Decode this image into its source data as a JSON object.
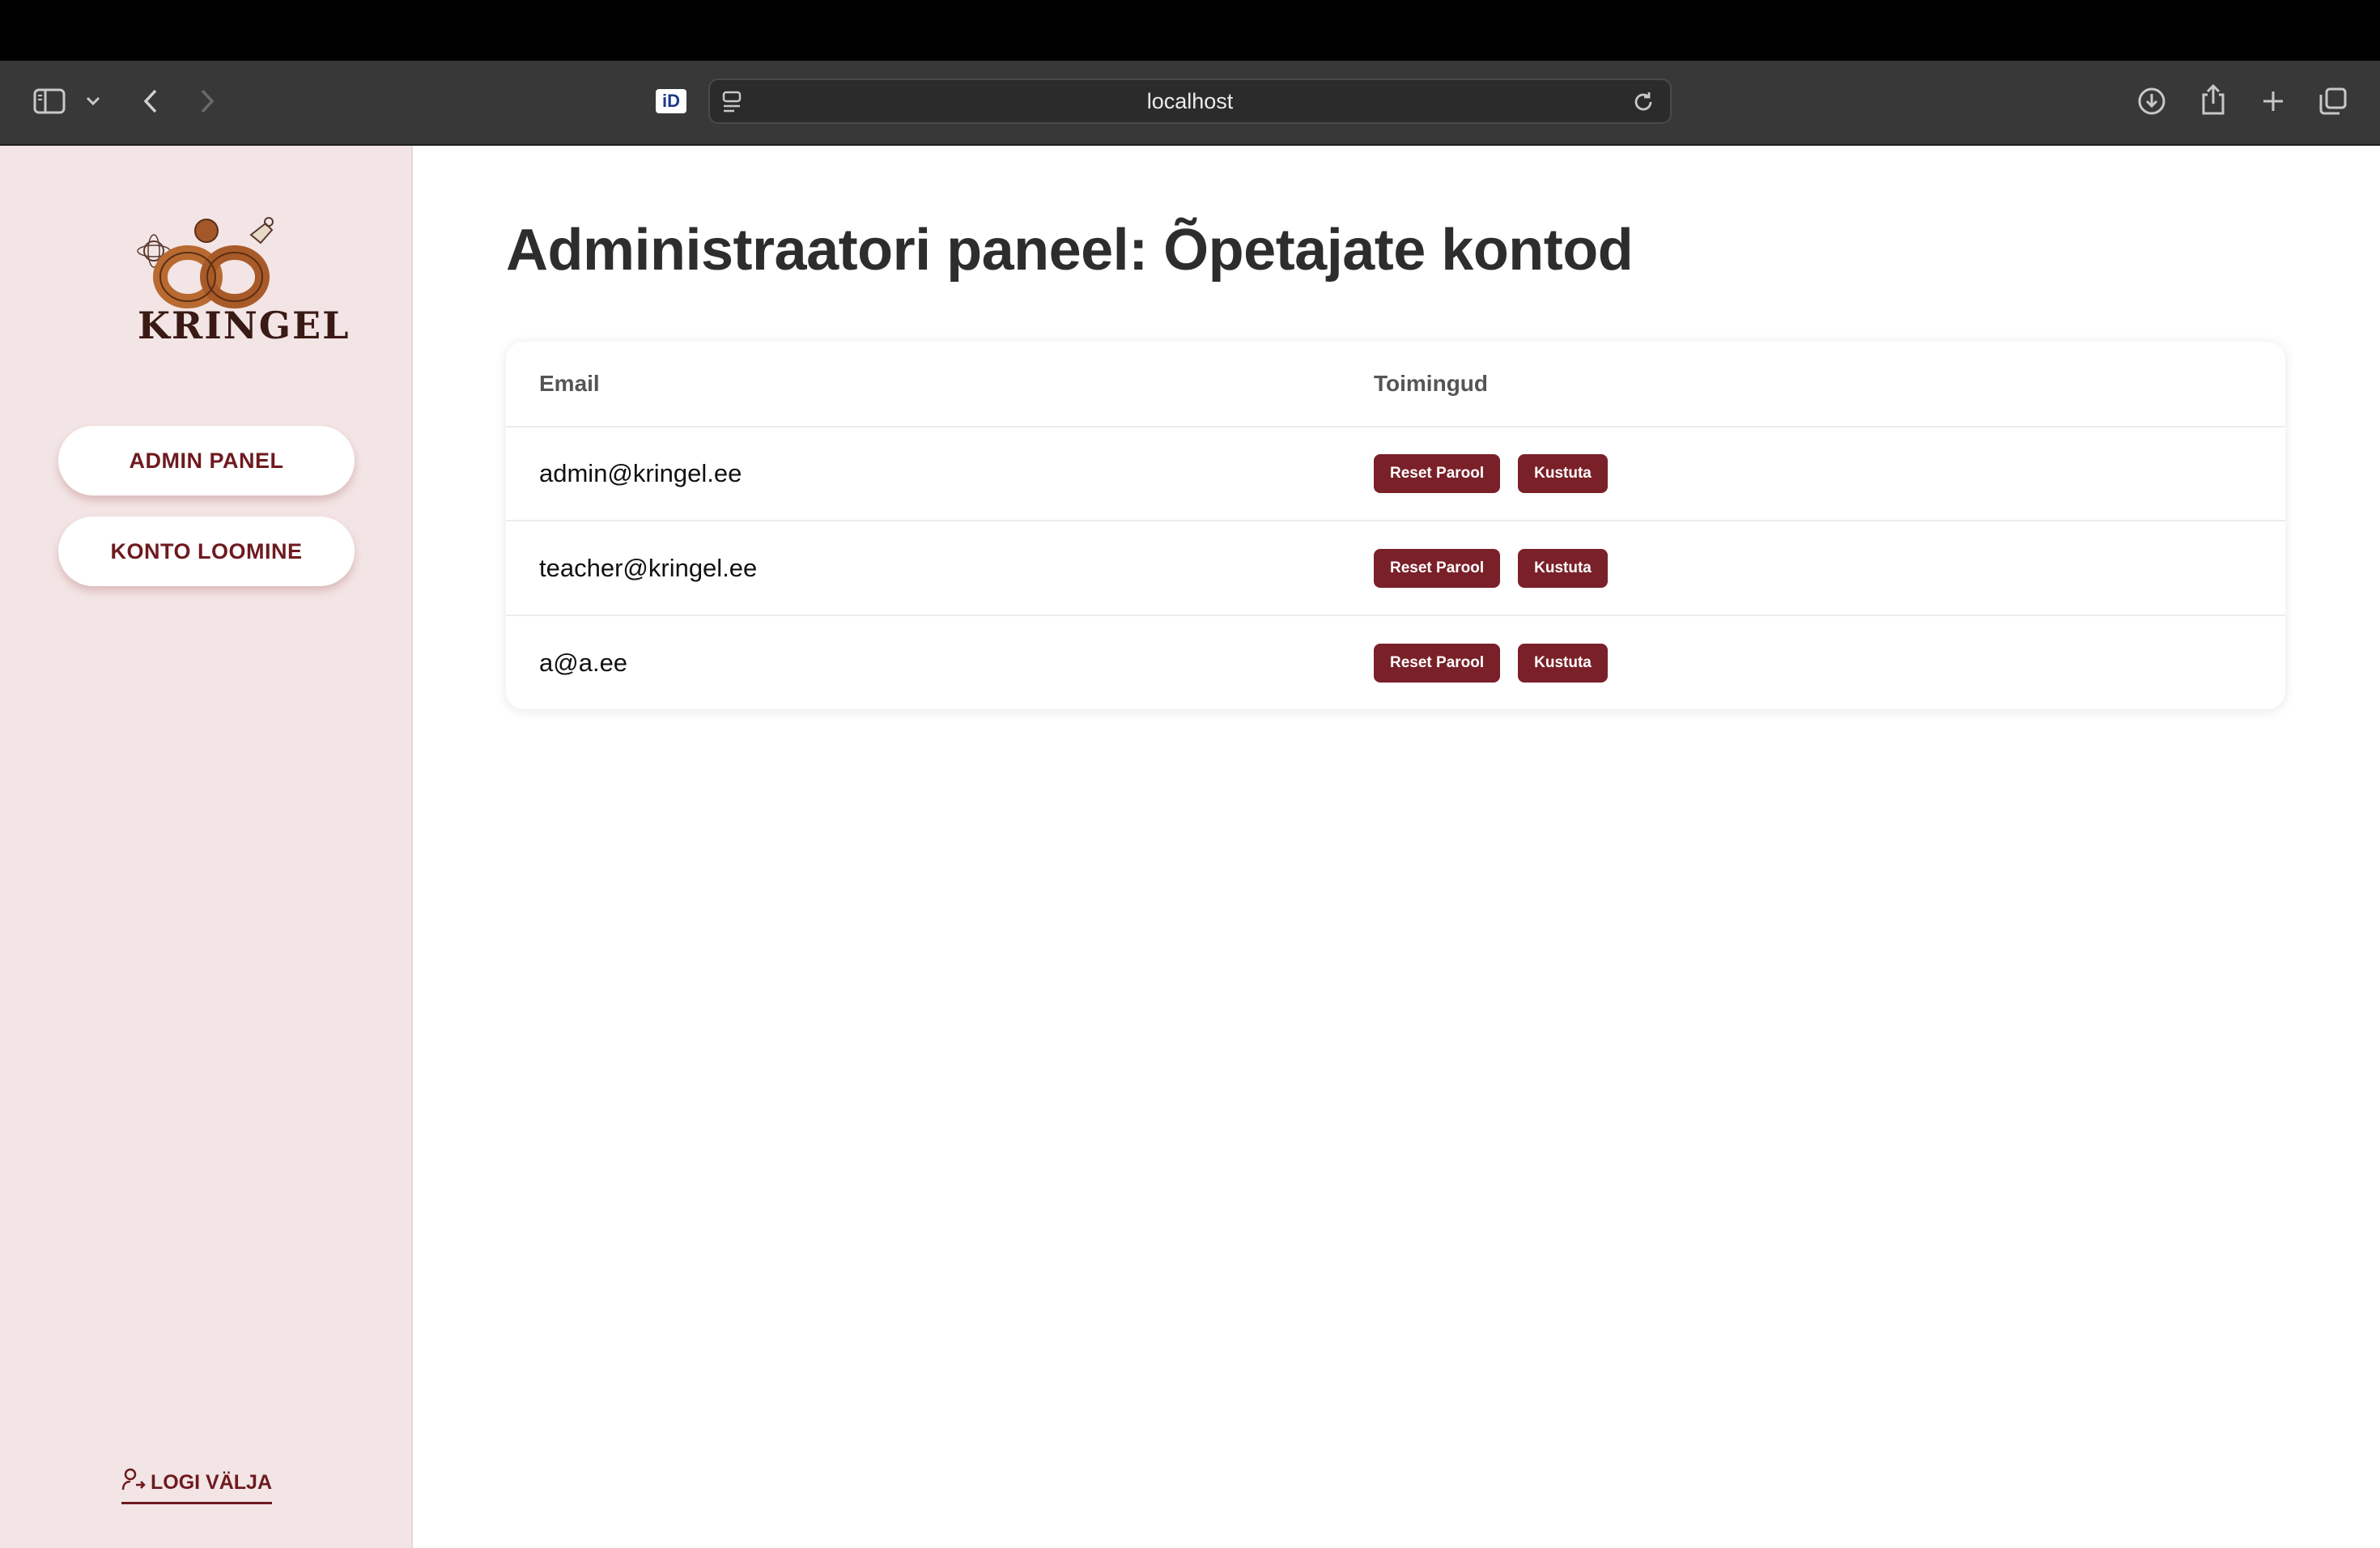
{
  "browser": {
    "url": "localhost",
    "id_badge": "iD"
  },
  "sidebar": {
    "logo_text": "KRINGEL",
    "nav": [
      {
        "label": "ADMIN PANEL"
      },
      {
        "label": "KONTO LOOMINE"
      }
    ],
    "logout_label": "LOGI VÄLJA"
  },
  "main": {
    "title": "Administraatori paneel: Õpetajate kontod",
    "table": {
      "headers": [
        "Email",
        "Toimingud"
      ],
      "rows": [
        {
          "email": "admin@kringel.ee",
          "reset_label": "Reset Parool",
          "delete_label": "Kustuta"
        },
        {
          "email": "teacher@kringel.ee",
          "reset_label": "Reset Parool",
          "delete_label": "Kustuta"
        },
        {
          "email": "a@a.ee",
          "reset_label": "Reset Parool",
          "delete_label": "Kustuta"
        }
      ]
    }
  },
  "colors": {
    "accent": "#7a2029",
    "sidebar_bg": "#f3e5e5"
  }
}
